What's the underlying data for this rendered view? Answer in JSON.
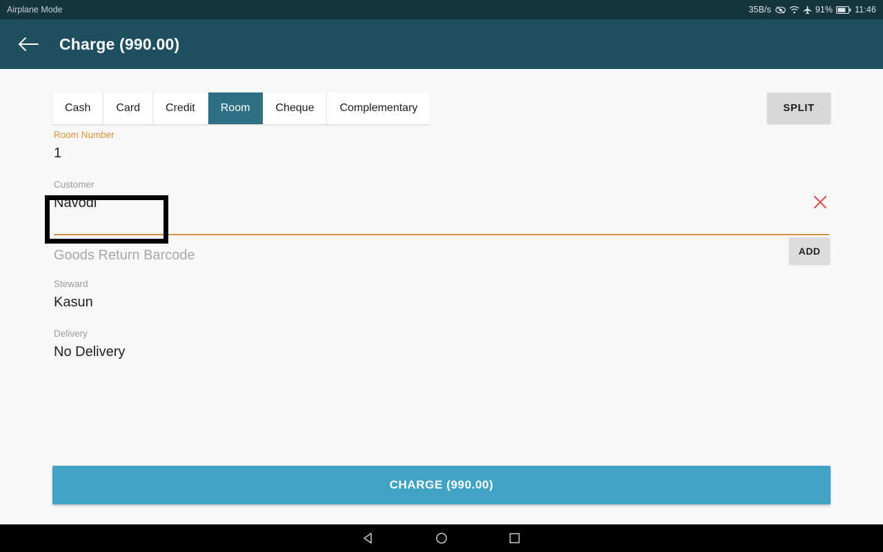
{
  "status_bar": {
    "left_text": "Airplane Mode",
    "net_speed": "35B/s",
    "battery_percent": "91%",
    "clock": "11:46",
    "icons": [
      "eye-icon",
      "wifi-icon",
      "airplane-icon",
      "battery-icon"
    ],
    "background_color": "#15343c"
  },
  "app_bar": {
    "back_icon": "back-arrow-icon",
    "title": "Charge (990.00)",
    "background_color": "#1d4f5e"
  },
  "tabs": {
    "items": [
      {
        "label": "Cash",
        "selected": false
      },
      {
        "label": "Card",
        "selected": false
      },
      {
        "label": "Credit",
        "selected": false
      },
      {
        "label": "Room",
        "selected": true
      },
      {
        "label": "Cheque",
        "selected": false
      },
      {
        "label": "Complementary",
        "selected": false
      }
    ],
    "selected_color": "#2e7085"
  },
  "toolbar": {
    "split_label": "SPLIT",
    "add_label": "ADD"
  },
  "fields": {
    "room_number": {
      "label": "Room Number",
      "value": "1",
      "accent_color": "#dc9038"
    },
    "customer": {
      "label": "Customer",
      "value": "Navodi",
      "clear_icon": "close-x-icon",
      "clear_icon_color": "#e04b4b"
    },
    "goods_return_barcode": {
      "placeholder": "Goods Return Barcode",
      "value": ""
    },
    "steward": {
      "label": "Steward",
      "value": "Kasun"
    },
    "delivery": {
      "label": "Delivery",
      "value": "No Delivery"
    }
  },
  "charge_button": {
    "label": "CHARGE (990.00)",
    "color": "#41a3c4"
  },
  "nav_bar": {
    "back_label": "back-triangle-icon",
    "home_label": "home-circle-icon",
    "recents_label": "recents-square-icon"
  }
}
